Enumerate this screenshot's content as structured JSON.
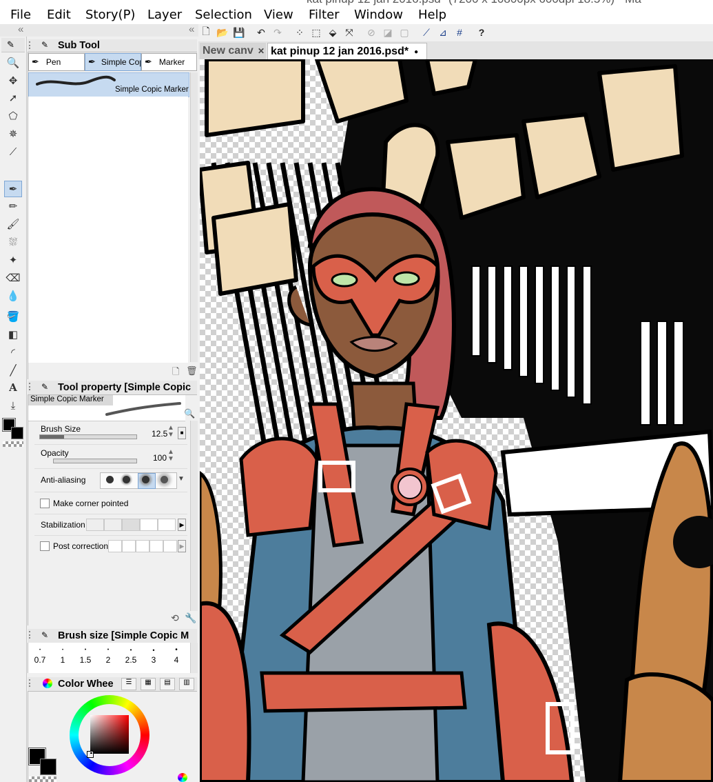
{
  "window": {
    "title_fragment": "kat pinup 12 jan 2016.psd* (7200 x 10800px 600dpi 18.5%) - Ma"
  },
  "menu": [
    "File",
    "Edit",
    "Story(P)",
    "Layer",
    "Selection",
    "View",
    "Filter",
    "Window",
    "Help"
  ],
  "subtool": {
    "title": "Sub Tool",
    "tabs": [
      "Pen",
      "Simple Cop",
      "Marker"
    ],
    "active_brush": "Simple Copic Marker"
  },
  "tool_property": {
    "title": "Tool property [Simple Copic",
    "brush_name": "Simple Copic Marker",
    "brush_size_label": "Brush Size",
    "brush_size_value": "12.5",
    "opacity_label": "Opacity",
    "opacity_value": "100",
    "antialias_label": "Anti-aliasing",
    "corner_label": "Make corner pointed",
    "stabilization_label": "Stabilization",
    "post_correction_label": "Post correction"
  },
  "brush_size_panel": {
    "title": "Brush size [Simple Copic M",
    "sizes": [
      "0.7",
      "1",
      "1.5",
      "2",
      "2.5",
      "3",
      "4"
    ]
  },
  "color_panel": {
    "title": "Color Whee"
  },
  "doc_tabs": [
    {
      "label": "New canv",
      "active": false
    },
    {
      "label": "kat pinup 12 jan 2016.psd*",
      "active": true
    }
  ],
  "colors": {
    "selection": "#c6daf0",
    "accent_border": "#7ea6d4",
    "main_color": "#000000",
    "sub_color": "#ffffff"
  }
}
